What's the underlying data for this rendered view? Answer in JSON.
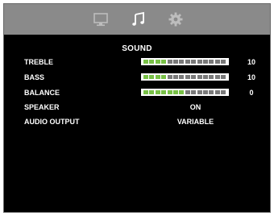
{
  "tabs": [
    {
      "name": "display",
      "icon": "monitor-icon",
      "active": false
    },
    {
      "name": "sound",
      "icon": "music-note-icon",
      "active": true
    },
    {
      "name": "settings",
      "icon": "gear-icon",
      "active": false
    }
  ],
  "colors": {
    "accent_bar": "#78c046",
    "bar_off": "#7a7a7a",
    "tab_bg": "#8a8a8a",
    "background": "#000000"
  },
  "title": "SOUND",
  "items": [
    {
      "label": "TREBLE",
      "value": "10",
      "level": 0.3
    },
    {
      "label": "BASS",
      "value": "10",
      "level": 0.3
    },
    {
      "label": "BALANCE",
      "value": "0",
      "level": 0.5
    },
    {
      "label": "SPEAKER",
      "value": "ON"
    },
    {
      "label": "AUDIO OUTPUT",
      "value": "VARIABLE"
    }
  ]
}
